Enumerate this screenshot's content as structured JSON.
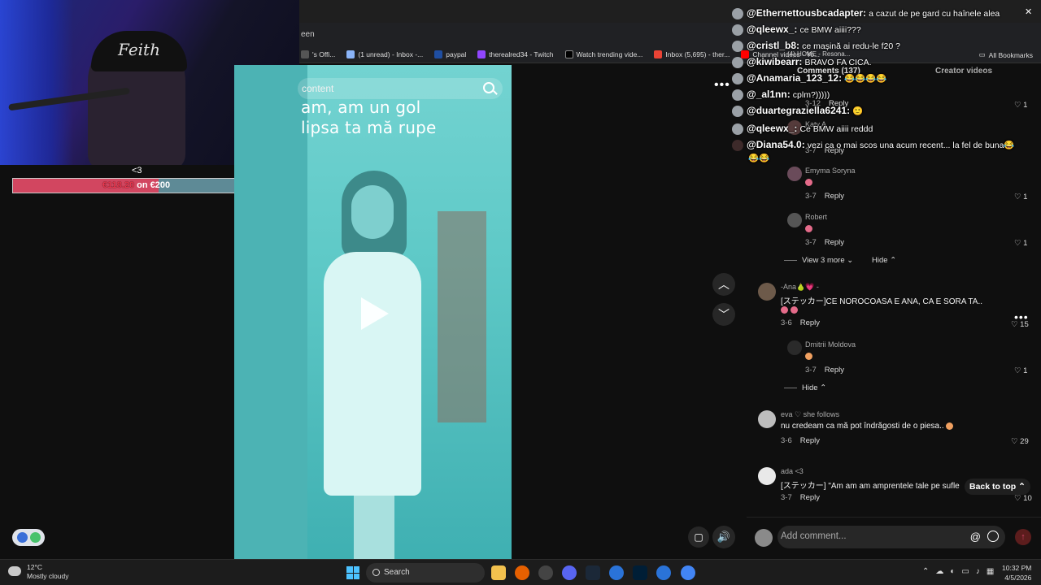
{
  "browser": {
    "tab_title": "een",
    "bookmarks": [
      {
        "label": "'s Offi..."
      },
      {
        "label": "(1 unread) - Inbox -..."
      },
      {
        "label": "paypal"
      },
      {
        "label": "therealred34 - Twitch"
      },
      {
        "label": "Watch trending vide..."
      },
      {
        "label": "Inbox (5,695) - ther..."
      },
      {
        "label": "Channel videos - Yo..."
      }
    ],
    "all_bookmarks": "All Bookmarks",
    "extra_tab": "(4) HOME - Resona..."
  },
  "stream": {
    "cap_text": "Feith",
    "heart": "<3",
    "donation_amount": "€118.20",
    "donation_goal_text": "on €200",
    "donation_progress": 0.591
  },
  "video": {
    "search_placeholder": "content",
    "lyric_line1": "am, am un gol",
    "lyric_line2": "lipsa ta mă rupe"
  },
  "comments_header": {
    "title": "Comments (137)",
    "creator": "Creator videos"
  },
  "comments": [
    {
      "time": "3-12",
      "reply": "Reply",
      "likes": "1"
    },
    {
      "name": "Katy A",
      "time": "3-7",
      "reply": "Reply"
    },
    {
      "name": "Emyma Soryna",
      "time": "3-7",
      "reply": "Reply",
      "likes": "1"
    },
    {
      "name": "Robert",
      "time": "3-7",
      "reply": "Reply",
      "likes": "1"
    },
    {
      "name": "-Ana🍐💗 -",
      "text": "[ステッカー]CE NOROCOASA E ANA, CA E SORA TA..",
      "time": "3-6",
      "reply": "Reply",
      "likes": "15"
    },
    {
      "name": "Dmitrii Moldova",
      "time": "3-7",
      "reply": "Reply",
      "likes": "1"
    },
    {
      "name": "eva ♡ she follows",
      "text": "nu credeam ca mă pot îndrăgosti de o piesa..",
      "time": "3-6",
      "reply": "Reply",
      "likes": "29"
    },
    {
      "name": "ada <3",
      "text": "[ステッカー] \"Am am am amprentele tale pe sufle",
      "time": "3-7",
      "reply": "Reply",
      "likes": "10"
    }
  ],
  "collapse": {
    "view_more": "View 3 more",
    "hide1": "Hide",
    "hide2": "Hide"
  },
  "back_to_top": "Back to top",
  "add_comment": {
    "placeholder": "Add comment...",
    "at": "@"
  },
  "chat": [
    {
      "user": "@Ethernettousbcadapter:",
      "msg": "a cazut de pe gard cu haînele alea",
      "color": "#ffffff"
    },
    {
      "user": "@qleewx_:",
      "msg": "ce BMW aiiii???",
      "color": "#ffffff"
    },
    {
      "user": "@cristl_b8:",
      "msg": "ce mașină ai redu-le f20 ?",
      "color": "#ffffff"
    },
    {
      "user": "@kiwibearr:",
      "msg": "BRAVO FA CICA.",
      "color": "#ffffff"
    },
    {
      "user": "@Anamaria_123_12:",
      "msg": "😂😂😂😂",
      "color": "#ffffff"
    },
    {
      "user": "@_al1nn:",
      "msg": "cplm?)))))",
      "color": "#ffffff"
    },
    {
      "user": "@duartegraziella6241:",
      "msg": "🙂",
      "color": "#ffffff"
    },
    {
      "user": "@qleewx_:",
      "msg": "Ce BMW aiiii reddd",
      "color": "#ffffff"
    },
    {
      "user": "@Diana54.0:",
      "msg": "vezi ca o mai scos una acum recent... la fel de buna😂",
      "color": "#ffffff"
    },
    {
      "user": "",
      "msg": "😂😂",
      "color": "#ffffff"
    }
  ],
  "taskbar": {
    "temp": "12°C",
    "weather": "Mostly cloudy",
    "search": "Search",
    "time": "10:32 PM",
    "date": "4/5/2026"
  }
}
